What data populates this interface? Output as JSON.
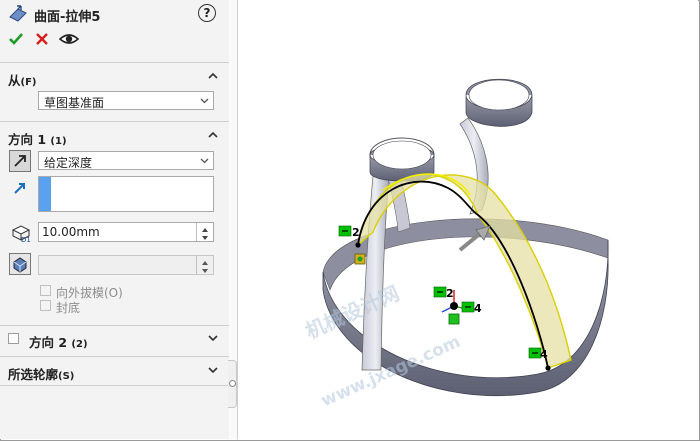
{
  "feature": {
    "title": "曲面-拉伸5",
    "help_label": "?",
    "icon": "surface-extrude-icon"
  },
  "actions": {
    "ok_icon": "checkmark-icon",
    "cancel_icon": "close-icon",
    "preview_icon": "eye-icon"
  },
  "from_section": {
    "label": "从",
    "shortcut": "(F)",
    "selected": "草图基准面"
  },
  "direction1": {
    "label": "方向 1",
    "shortcut": "(1)",
    "end_condition": "给定深度",
    "depth": "10.00mm",
    "draft_outward": "向外拔模(O)",
    "cap_end": "封底"
  },
  "direction2": {
    "label": "方向 2",
    "shortcut": "(2)",
    "checked": false
  },
  "selected_contours": {
    "label": "所选轮廓",
    "shortcut": "(S)"
  },
  "viewport": {
    "tags": {
      "left_arc": "2",
      "right_arc": "4",
      "origin_top": "2",
      "origin_right": "4"
    },
    "watermark_cn": "机械设计网",
    "watermark_url": "www.jxage.com",
    "colors": {
      "band": "#7a7d8e",
      "sketch_green": "#00c000",
      "highlight": "#f0f000"
    }
  }
}
